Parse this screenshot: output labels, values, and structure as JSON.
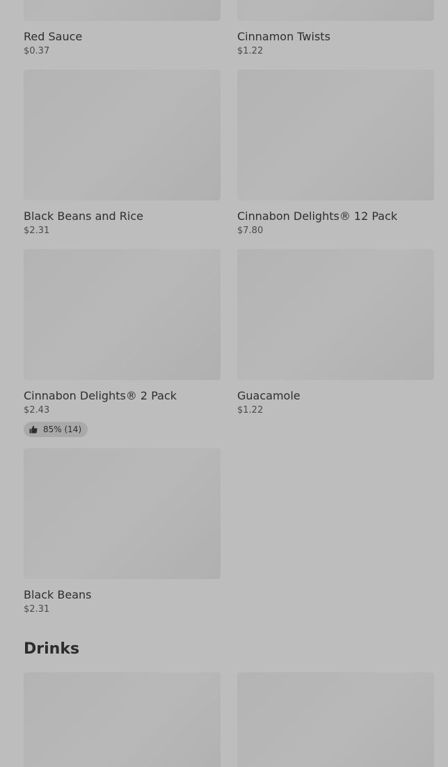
{
  "items": [
    {
      "name": "Red Sauce",
      "price": "$0.37"
    },
    {
      "name": "Cinnamon Twists",
      "price": "$1.22"
    },
    {
      "name": "Black Beans and Rice",
      "price": "$2.31"
    },
    {
      "name": "Cinnabon Delights® 12 Pack",
      "price": "$7.80"
    },
    {
      "name": "Cinnabon Delights® 2 Pack",
      "price": "$2.43",
      "rating": "85% (14)"
    },
    {
      "name": "Guacamole",
      "price": "$1.22"
    },
    {
      "name": "Black Beans",
      "price": "$2.31"
    }
  ],
  "sections": {
    "drinks_title": "Drinks"
  },
  "icons": {
    "rating_icon": "thumbs-up-icon"
  }
}
